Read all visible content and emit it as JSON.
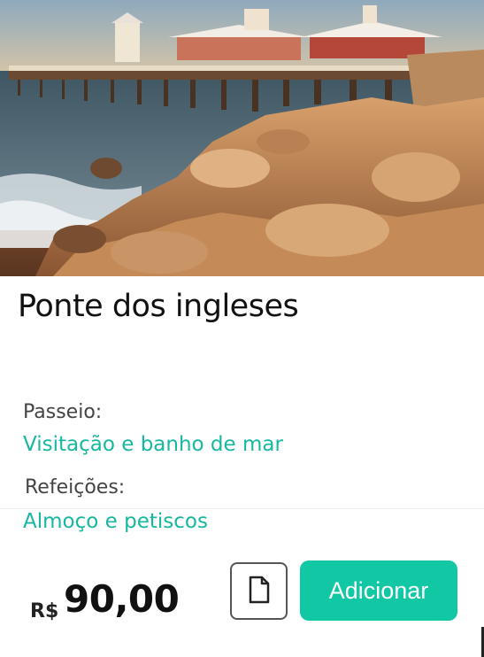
{
  "product": {
    "image_alt": "Ponte dos ingleses",
    "title": "Ponte dos ingleses"
  },
  "details": {
    "tour_label": "Passeio:",
    "tour_value": "Visitação e banho de mar",
    "meals_label": "Refeições:",
    "meals_value": "Almoço e petiscos"
  },
  "price": {
    "currency": "R$",
    "amount": "90,00"
  },
  "actions": {
    "doc_icon": "document-icon",
    "add_label": "Adicionar"
  },
  "colors": {
    "accent": "#12c7a3",
    "value_text": "#17b7a0"
  }
}
